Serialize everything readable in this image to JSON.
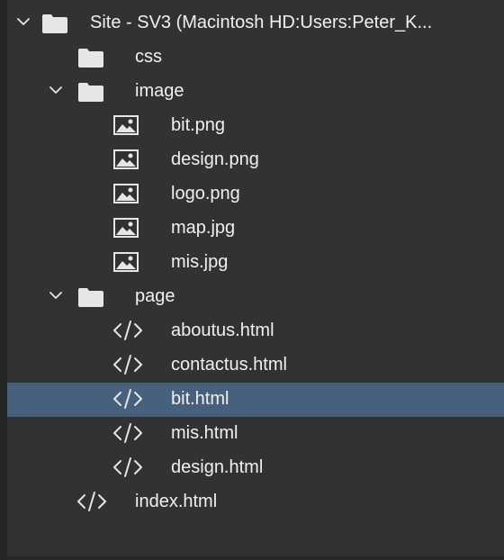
{
  "tree": {
    "root": {
      "label": "Site - SV3 (Macintosh HD:Users:Peter_K...",
      "expanded": true
    },
    "css": {
      "label": "css"
    },
    "image": {
      "label": "image",
      "expanded": true,
      "files": [
        "bit.png",
        "design.png",
        "logo.png",
        "map.jpg",
        "mis.jpg"
      ]
    },
    "page": {
      "label": "page",
      "expanded": true,
      "files": [
        "aboutus.html",
        "contactus.html",
        "bit.html",
        "mis.html",
        "design.html"
      ],
      "selected_file": "bit.html"
    },
    "index": {
      "label": "index.html"
    }
  },
  "colors": {
    "background": "#323232",
    "selected_row": "#47617d",
    "text": "#f0f0f0",
    "icon": "#e6e6e6"
  }
}
